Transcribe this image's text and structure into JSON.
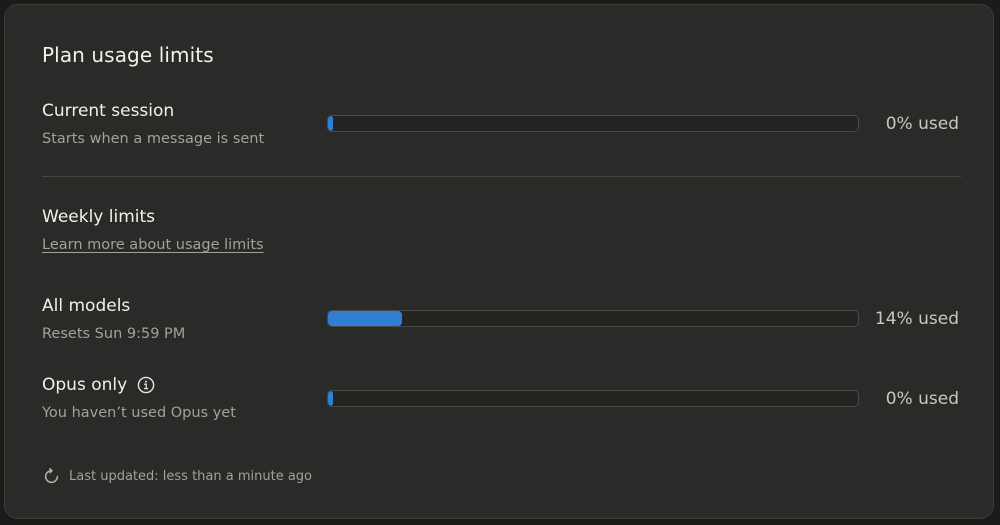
{
  "title": "Plan usage limits",
  "colors": {
    "accent": "#2f7fd6",
    "background": "#2a2a28",
    "track": "#232321"
  },
  "current_session": {
    "title": "Current session",
    "subtitle": "Starts when a message is sent",
    "used_fraction": 0.0,
    "used_label": "0% used"
  },
  "weekly": {
    "title": "Weekly limits",
    "link_text": "Learn more about usage limits"
  },
  "all_models": {
    "title": "All models",
    "subtitle": "Resets Sun 9:59 PM",
    "used_fraction": 0.14,
    "used_label": "14% used"
  },
  "opus_only": {
    "title": "Opus only",
    "subtitle": "You haven’t used Opus yet",
    "used_fraction": 0.0,
    "used_label": "0% used",
    "info_icon": "info-circle-icon"
  },
  "footer": {
    "last_updated": "Last updated: less than a minute ago",
    "refresh_icon": "refresh-icon"
  }
}
